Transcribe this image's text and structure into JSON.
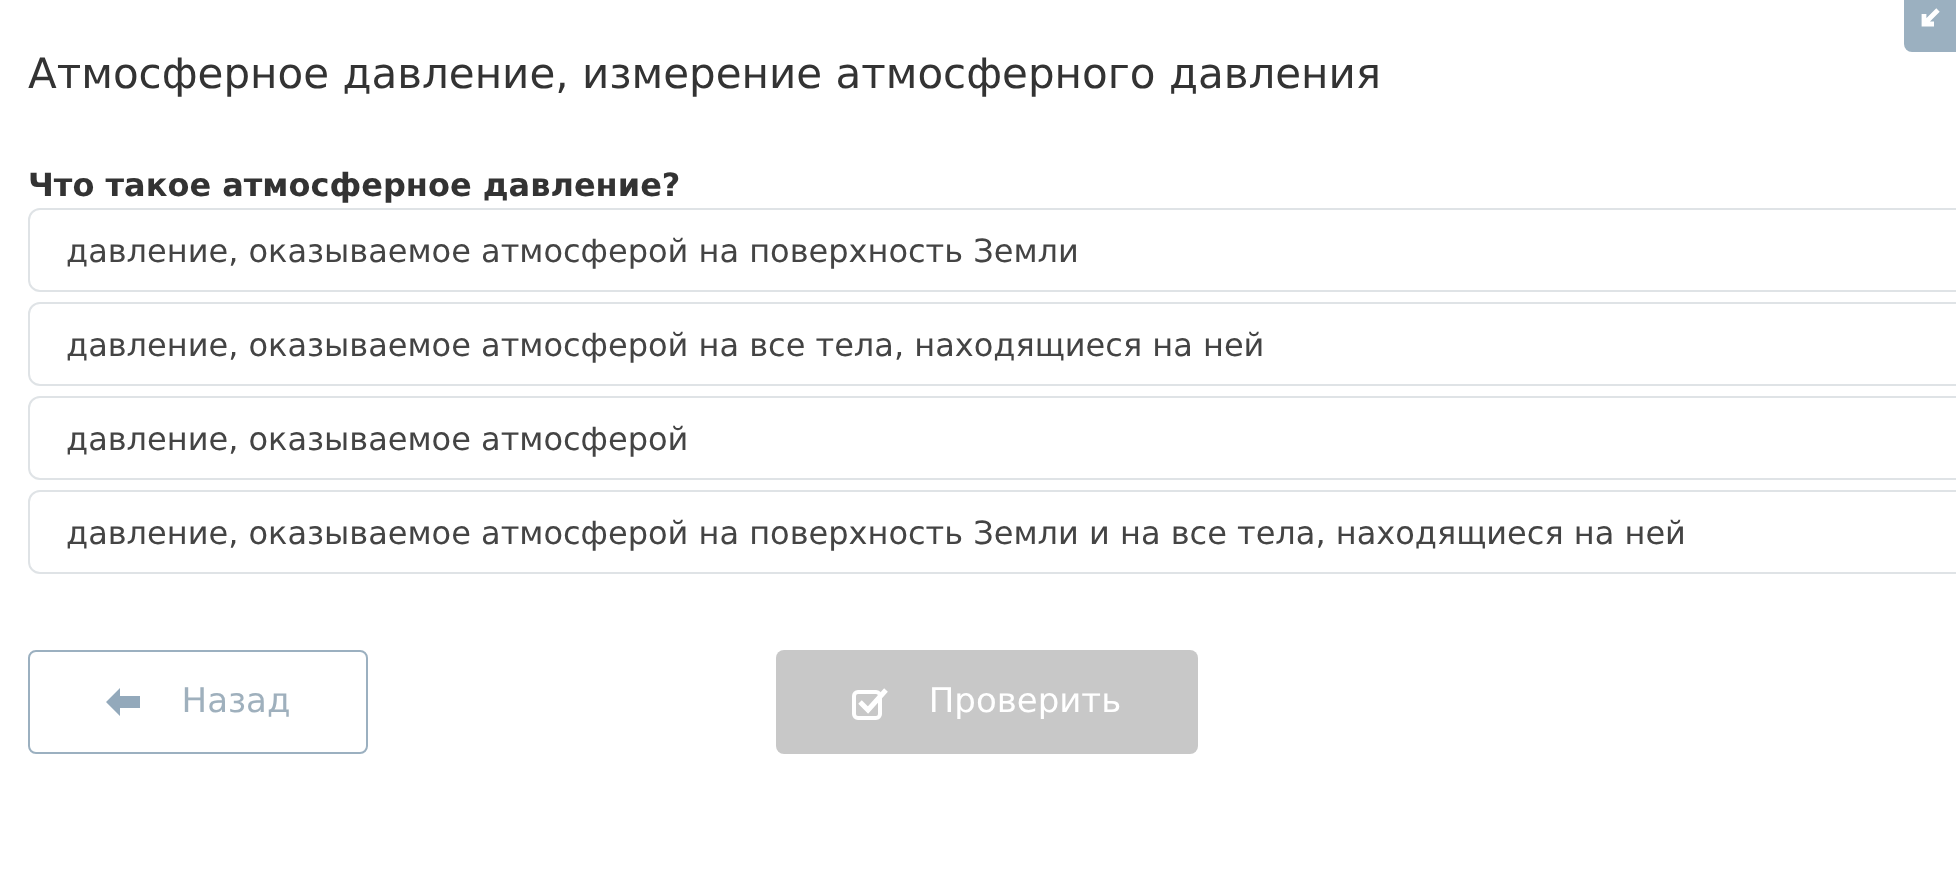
{
  "title": "Атмосферное давление, измерение атмосферного давления",
  "question": "Что такое атмосферное давление?",
  "options": [
    {
      "text": "давление, оказываемое атмосферой на поверхность Земли",
      "selected": false
    },
    {
      "text": "давление, оказываемое атмосферой на все тела, находящиеся на ней",
      "selected": false
    },
    {
      "text": "давление, оказываемое атмосферой",
      "selected": false
    },
    {
      "text": "давление, оказываемое атмосферой на поверхность Земли и на все тела, находящиеся на ней",
      "selected": false
    }
  ],
  "back_button": {
    "label": "Назад"
  },
  "check_button": {
    "label": "Проверить",
    "disabled": true
  }
}
